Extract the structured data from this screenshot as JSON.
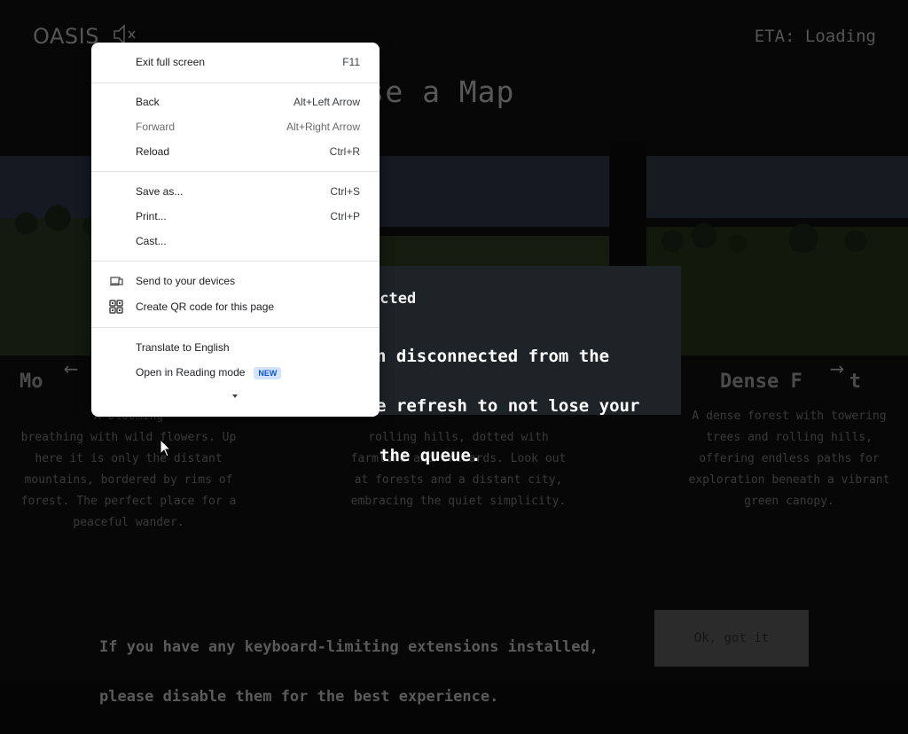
{
  "header": {
    "logo": "OASIS",
    "eta": "ETA: Loading",
    "sound_icon": "muted-speaker-icon"
  },
  "main": {
    "title": "Choose a Map"
  },
  "maps": [
    {
      "title": "Mo",
      "desc": "A blooming\nbreathing with wild flowers. Up\nhere it is only the distant\nmountains, bordered by rims of\nforest. The perfect place for a\npeaceful wander."
    },
    {
      "title": "",
      "desc": "rolling hills, dotted with\nfarmland and orchards. Look out\nat forests and a distant city,\nembracing the quiet simplicity."
    },
    {
      "title": "Dense F    t",
      "desc": "A dense forest with towering\ntrees and rolling hills,\noffering endless paths for\nexploration beneath a vibrant\ngreen canopy."
    }
  ],
  "disconnect": {
    "heading": "ected",
    "body_line1": "n disconnected from the",
    "body_line2": "e refresh to not lose your",
    "body_line3": "the queue."
  },
  "footer": {
    "note_line1": "If you have any keyboard-limiting extensions installed,",
    "note_line2": "please disable them for the best experience.",
    "ok_label": "Ok, got it"
  },
  "context_menu": {
    "exit_fullscreen": {
      "label": "Exit full screen",
      "shortcut": "F11"
    },
    "back": {
      "label": "Back",
      "shortcut": "Alt+Left Arrow"
    },
    "forward": {
      "label": "Forward",
      "shortcut": "Alt+Right Arrow"
    },
    "reload": {
      "label": "Reload",
      "shortcut": "Ctrl+R"
    },
    "save_as": {
      "label": "Save as...",
      "shortcut": "Ctrl+S"
    },
    "print": {
      "label": "Print...",
      "shortcut": "Ctrl+P"
    },
    "cast": {
      "label": "Cast..."
    },
    "send_devices": {
      "label": "Send to your devices"
    },
    "qr_code": {
      "label": "Create QR code for this page"
    },
    "translate": {
      "label": "Translate to English"
    },
    "reading_mode": {
      "label": "Open in Reading mode",
      "badge": "NEW"
    }
  }
}
